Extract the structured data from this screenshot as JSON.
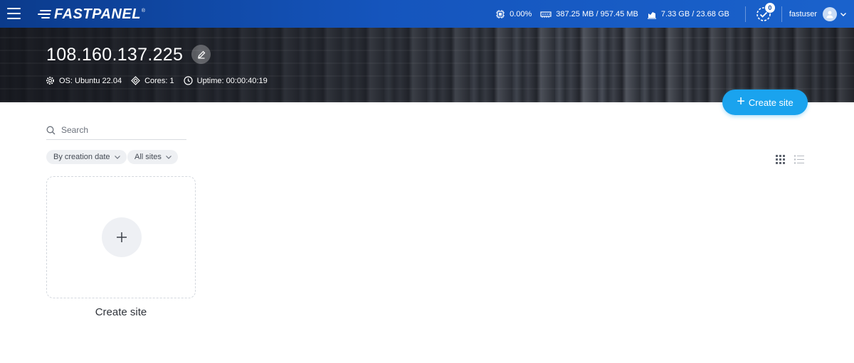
{
  "header": {
    "logo_text": "FASTPANEL",
    "logo_reg": "®",
    "cpu": "0.00%",
    "ram": "387.25 MB / 957.45 MB",
    "disk": "7.33 GB / 23.68 GB",
    "tasks_count": "0",
    "username": "fastuser"
  },
  "server": {
    "ip": "108.160.137.225",
    "os": "OS: Ubuntu 22.04",
    "cores": "Cores: 1",
    "uptime": "Uptime: 00:00:40:19"
  },
  "actions": {
    "create_site_label": "Create site"
  },
  "search": {
    "placeholder": "Search"
  },
  "filters": {
    "sort_label": "By creation date",
    "scope_label": "All sites"
  },
  "card": {
    "label": "Create site"
  },
  "colors": {
    "accent": "#1aa3ee",
    "topbar": "#1555bd"
  }
}
